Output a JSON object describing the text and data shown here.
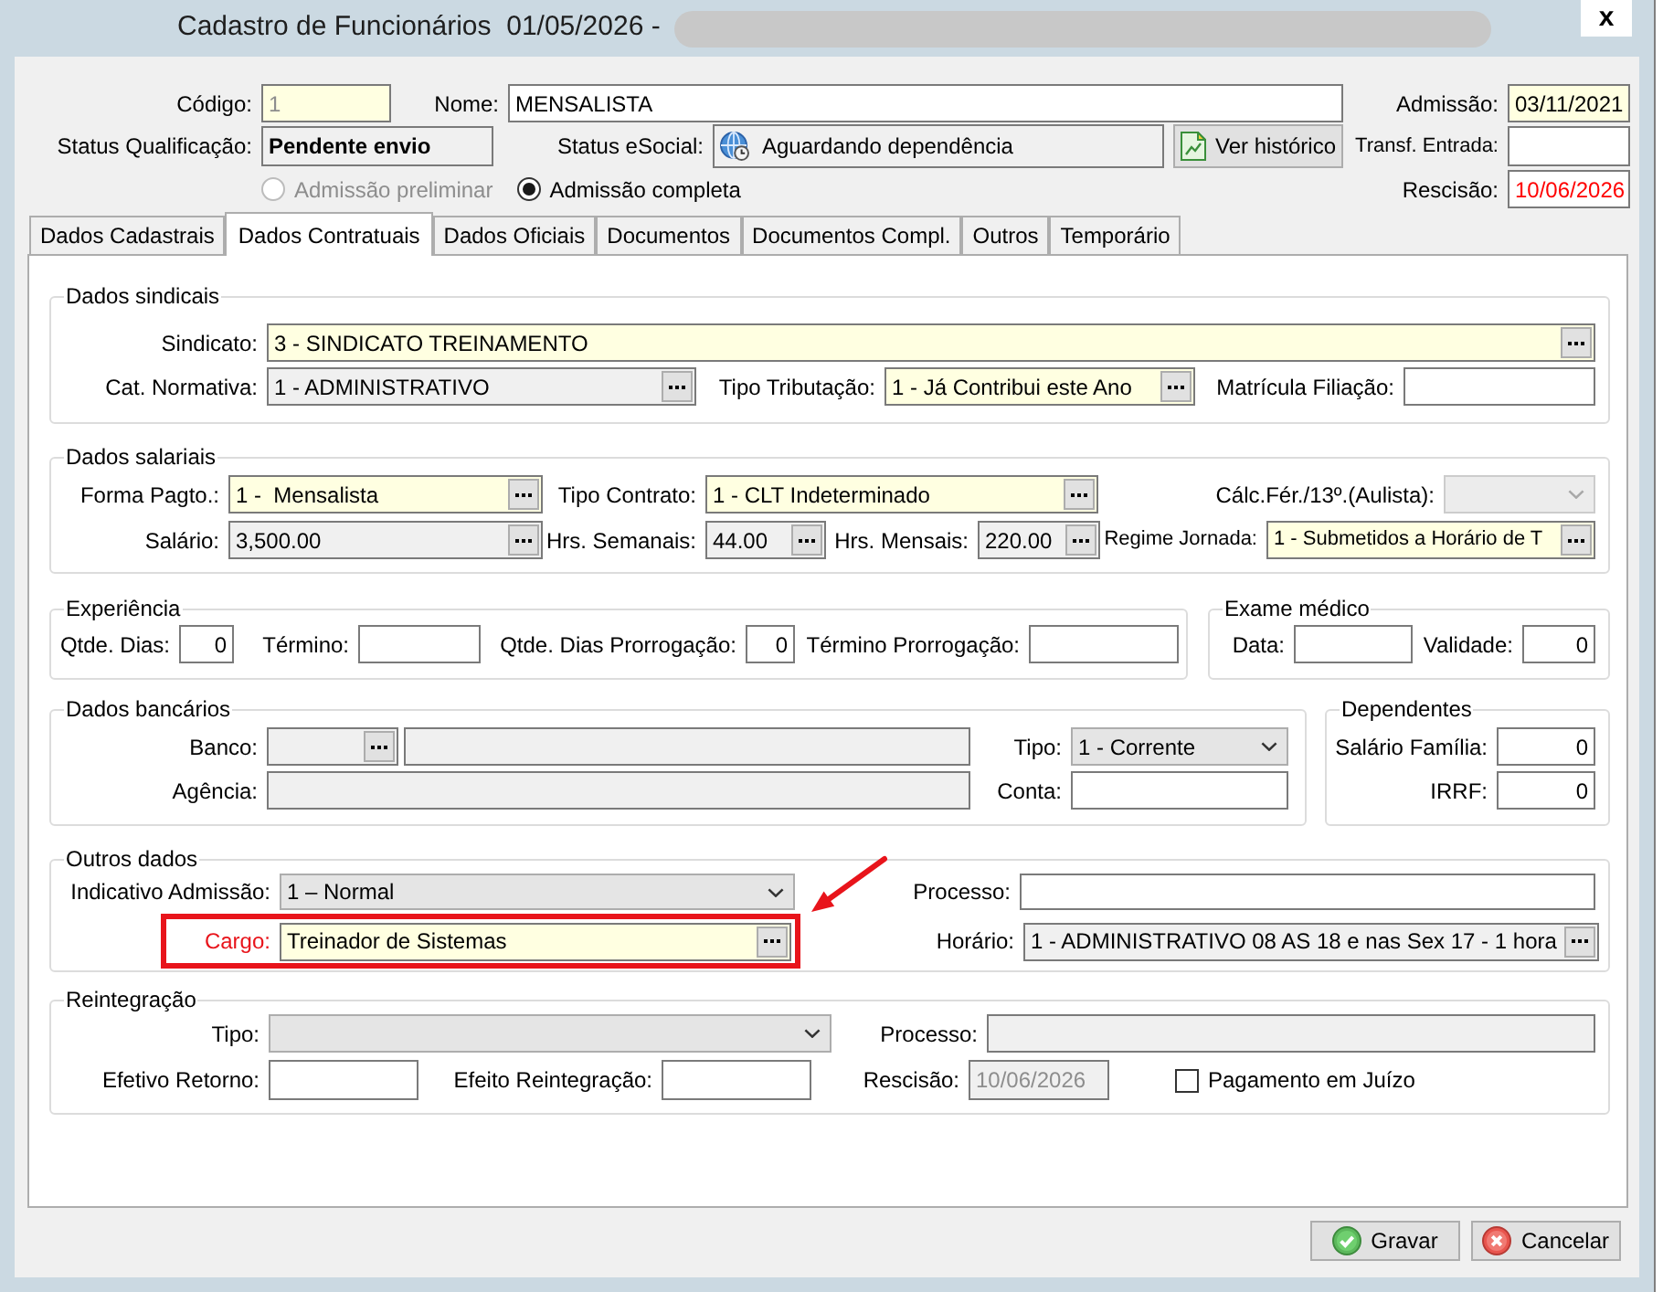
{
  "window": {
    "title": "Cadastro de Funcionários  01/05/2026 -",
    "close": "x"
  },
  "header": {
    "lines": [
      {
        "items": [
          {
            "kind": "text",
            "label": "Código:",
            "value": "1",
            "required": true,
            "disabled": true
          },
          {
            "kind": "text",
            "label": "Nome:",
            "value": "MENSALISTA"
          },
          {
            "kind": "text",
            "label": "Admissão:",
            "value": "03/11/2021",
            "required": true
          }
        ]
      },
      {
        "items": [
          {
            "kind": "status",
            "label": "Status Qualificação:",
            "value": "Pendente envio",
            "readonly": true
          },
          {
            "kind": "icon_text",
            "label": "Status eSocial:",
            "value": "Aguardando dependência",
            "readonly": true
          },
          {
            "kind": "button",
            "label": "Ver histórico"
          },
          {
            "kind": "text",
            "label": "Transf. Entrada:"
          }
        ]
      },
      {
        "items": [
          {
            "kind": "radio",
            "label": "Admissão preliminar",
            "selected": false,
            "disabled": true
          },
          {
            "kind": "radio",
            "label": "Admissão completa",
            "selected": true
          },
          {
            "kind": "text",
            "label": "Rescisão:",
            "value": "10/06/2026",
            "alert": true
          }
        ]
      }
    ]
  },
  "tabs": [
    {
      "label": "Dados Cadastrais",
      "selected": false
    },
    {
      "label": "Dados Contratuais",
      "selected": true
    },
    {
      "label": "Dados Oficiais",
      "selected": false
    },
    {
      "label": "Documentos",
      "selected": false
    },
    {
      "label": "Documentos Compl.",
      "selected": false
    },
    {
      "label": "Outros",
      "selected": false
    },
    {
      "label": "Temporário",
      "selected": false
    }
  ],
  "panel": {
    "bands": [
      {
        "groups": [
          {
            "title": "Dados sindicais",
            "lines": [
              {
                "fields": [
                  {
                    "kind": "lookup",
                    "label": "Sindicato:",
                    "value": "3 - SINDICATO TREINAMENTO",
                    "required": true
                  }
                ]
              },
              {
                "fields": [
                  {
                    "kind": "lookup",
                    "label": "Cat. Normativa:",
                    "value": "1 - ADMINISTRATIVO",
                    "readonly": true
                  },
                  {
                    "kind": "lookup",
                    "label": "Tipo Tributação:",
                    "value": "1 - Já Contribui este Ano",
                    "required": true
                  },
                  {
                    "kind": "text",
                    "label": "Matrícula Filiação:"
                  }
                ]
              }
            ]
          }
        ]
      },
      {
        "groups": [
          {
            "title": "Dados salariais",
            "lines": [
              {
                "fields": [
                  {
                    "kind": "lookup",
                    "label": "Forma Pagto.:",
                    "value": "1 -  Mensalista",
                    "required": true
                  },
                  {
                    "kind": "lookup",
                    "label": "Tipo Contrato:",
                    "value": "1 - CLT Indeterminado",
                    "required": true
                  },
                  {
                    "kind": "select",
                    "label": "Cálc.Fér./13º.(Aulista):",
                    "disabled": true
                  }
                ]
              },
              {
                "fields": [
                  {
                    "kind": "lookup",
                    "label": "Salário:",
                    "value": "3,500.00",
                    "readonly": true
                  },
                  {
                    "kind": "lookup",
                    "label": "Hrs. Semanais:",
                    "value": "44.00",
                    "readonly": true
                  },
                  {
                    "kind": "lookup",
                    "label": "Hrs. Mensais:",
                    "value": "220.00",
                    "readonly": true
                  },
                  {
                    "kind": "lookup",
                    "label": "Regime Jornada:",
                    "value": "1 - Submetidos a Horário de T",
                    "required": true
                  }
                ]
              }
            ]
          }
        ]
      },
      {
        "groups": [
          {
            "title": "Experiência",
            "lines": [
              {
                "fields": [
                  {
                    "kind": "number",
                    "label": "Qtde. Dias:",
                    "value": "0"
                  },
                  {
                    "kind": "text",
                    "label": "Término:"
                  },
                  {
                    "kind": "number",
                    "label": "Qtde. Dias Prorrogação:",
                    "value": "0"
                  },
                  {
                    "kind": "text",
                    "label": "Término Prorrogação:"
                  }
                ]
              }
            ]
          },
          {
            "title": "Exame médico",
            "lines": [
              {
                "fields": [
                  {
                    "kind": "text",
                    "label": "Data:"
                  },
                  {
                    "kind": "number",
                    "label": "Validade:",
                    "value": "0"
                  }
                ]
              }
            ]
          }
        ]
      },
      {
        "groups": [
          {
            "title": "Dados bancários",
            "lines": [
              {
                "fields": [
                  {
                    "kind": "lookup",
                    "label": "Banco:",
                    "readonly": true
                  },
                  {
                    "kind": "text",
                    "readonly": true
                  },
                  {
                    "kind": "select",
                    "label": "Tipo:",
                    "value": "1 - Corrente"
                  }
                ]
              },
              {
                "fields": [
                  {
                    "kind": "text",
                    "label": "Agência:",
                    "readonly": true
                  },
                  {
                    "kind": "text",
                    "label": "Conta:"
                  }
                ]
              }
            ]
          },
          {
            "title": "Dependentes",
            "lines": [
              {
                "fields": [
                  {
                    "kind": "number",
                    "label": "Salário Família:",
                    "value": "0"
                  }
                ]
              },
              {
                "fields": [
                  {
                    "kind": "number",
                    "label": "IRRF:",
                    "value": "0"
                  }
                ]
              }
            ]
          }
        ]
      },
      {
        "groups": [
          {
            "title": "Outros dados",
            "lines": [
              {
                "fields": [
                  {
                    "kind": "select",
                    "label": "Indicativo Admissão:",
                    "value": "1 – Normal"
                  },
                  {
                    "kind": "text",
                    "label": "Processo:"
                  }
                ]
              },
              {
                "fields": [
                  {
                    "kind": "lookup",
                    "label": "Cargo:",
                    "value": "Treinador de Sistemas",
                    "required": true,
                    "highlighted": true
                  },
                  {
                    "kind": "lookup",
                    "label": "Horário:",
                    "value": "1 - ADMINISTRATIVO 08 AS 18 e nas Sex 17 - 1 hora",
                    "readonly": true
                  }
                ]
              }
            ]
          }
        ]
      },
      {
        "groups": [
          {
            "title": "Reintegração",
            "lines": [
              {
                "fields": [
                  {
                    "kind": "select",
                    "label": "Tipo:"
                  },
                  {
                    "kind": "text",
                    "label": "Processo:",
                    "readonly": true
                  }
                ]
              },
              {
                "fields": [
                  {
                    "kind": "text",
                    "label": "Efetivo Retorno:"
                  },
                  {
                    "kind": "text",
                    "label": "Efeito Reintegração:"
                  },
                  {
                    "kind": "text",
                    "label": "Rescisão:",
                    "value": "10/06/2026",
                    "readonly": true,
                    "disabled": true
                  },
                  {
                    "kind": "checkbox",
                    "label": "Pagamento em Juízo",
                    "checked": false
                  }
                ]
              }
            ]
          }
        ]
      }
    ]
  },
  "buttons": [
    {
      "kind": "save",
      "label": "Gravar"
    },
    {
      "kind": "cancel",
      "label": "Cancelar"
    }
  ]
}
